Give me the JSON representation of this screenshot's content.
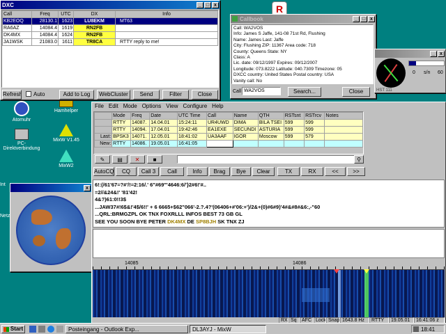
{
  "dxc": {
    "title": "DXC",
    "columns": [
      "Call",
      "Freq",
      "UTC",
      "DX",
      "Info"
    ],
    "rows": [
      [
        "KB2EOQ",
        "28130.1",
        "1623",
        "LU8EKM",
        "MT63"
      ],
      [
        "RA6AZ",
        "14084.4",
        "1619",
        "RN2FB",
        ""
      ],
      [
        "DK4MX",
        "14084.4",
        "1624",
        "RN2FB",
        ""
      ],
      [
        "JA1WSK",
        "21083.0",
        "1611",
        "TR8CA",
        "RTTY reply to me!"
      ]
    ],
    "refresh": "Refresh",
    "auto": "Auto",
    "add_log": "Add to Log",
    "webcluster": "WebCluster",
    "send": "Send",
    "filter": "Filter",
    "close": "Close"
  },
  "callbook": {
    "title": "Callbook",
    "lines": [
      "Call: WA2VOS",
      "Info: James S Jaffe, 141-08 71st Rd, Flushing",
      "Name: James  Last: Jaffe",
      "City: Flushing  ZIP: 11367  Area code: 718",
      "County: Queens  State: NY",
      "Class: A",
      "Lic. date: 09/12/1997  Expires: 09/12/2007",
      "Longitude: 073.8222  Latitude: 040.7309  Timezone: 05",
      "DXCC country: United States  Postal country: USA",
      "Vanity call: No"
    ],
    "call_label": "Call",
    "call_value": "WA2VOS",
    "search": "Search...",
    "close": "Close"
  },
  "meter": {
    "labels": [
      "0",
      "s/n",
      "60"
    ],
    "bottom": "HST 111"
  },
  "desktop": {
    "icons": [
      "Atomuhr",
      "Hamhelper",
      "PC-Direktverbindung",
      "MixW V1.45",
      "MixW2",
      "Int",
      "Netz"
    ]
  },
  "mixw": {
    "menu": [
      "File",
      "Edit",
      "Mode",
      "Options",
      "View",
      "Configure",
      "Help"
    ],
    "log_columns": [
      "",
      "Mode",
      "Freq",
      "Date",
      "UTC Time",
      "Call",
      "Name",
      "QTH",
      "RSTsnt",
      "RSTrcv",
      "Notes"
    ],
    "log_rows": [
      [
        "",
        "RTTY",
        "14087.",
        "14.04.01",
        "15:24:11",
        "UR4UWD",
        "DIMA",
        "BILA TSEI",
        "599",
        "599",
        ""
      ],
      [
        "",
        "RTTY",
        "14094.",
        "17.04.01",
        "19:42:46",
        "EA1EXE",
        "SECUNDI",
        "ASTURIA",
        "599",
        "599",
        ""
      ],
      [
        "Last:",
        "BPSK3",
        "14071.",
        "12.05.01",
        "18:41:02",
        "UA3AAF",
        "IGOR",
        "Moscow",
        "599",
        "579",
        ""
      ],
      [
        "New:",
        "RTTY",
        "14086.",
        "19.05.01",
        "16:41:05",
        "",
        "",
        "",
        "",
        "",
        ""
      ]
    ],
    "buttons": [
      "AutoCQ",
      "CQ",
      "Call 3",
      "Call",
      "Info",
      "Brag",
      "Bye",
      "Clear",
      "TX",
      "RX",
      "<<",
      ">>"
    ],
    "rx_lines": [
      "6!:(/61'67=?#'/!=2:16/.' 6\"#69\"'4646:6/'}2#6!'#..",
      "=2//&24&!' '81'42!",
      "4&?)61:0!!3$",
      "...JAW37#!6$&!'4$/6!!' + 6 6665+$62\"066'-2.?.4?'(06406+#'06:+')/2&+(0)#6#9)'4#&#8#&6:,-\"60",
      "...QRL:BRMGZPL OK TNX FOXRLLL INFOS  BEST 73 GB GL",
      "SEE YOU SOON BYE PETER"
    ],
    "rx_call1": "DK4MX",
    "rx_de": "DE",
    "rx_call2": "SP8BJH",
    "rx_end": "SK TNX ZJ",
    "scale": [
      "14085",
      "14086"
    ],
    "status": [
      "RX",
      "Sq",
      "AFC",
      "Lock",
      "Snap",
      "1643.8 Hz",
      "RTTY",
      "19.05.01",
      "16:41:06 z"
    ]
  },
  "taskbar": {
    "start": "Start",
    "tasks": [
      "Posteingang - Outlook Exp...",
      "DL3AYJ - MixW"
    ],
    "time": "18:41"
  },
  "colors": {
    "desktop": "#008080",
    "title_active": "#000080",
    "rx_call": "#a08000"
  }
}
